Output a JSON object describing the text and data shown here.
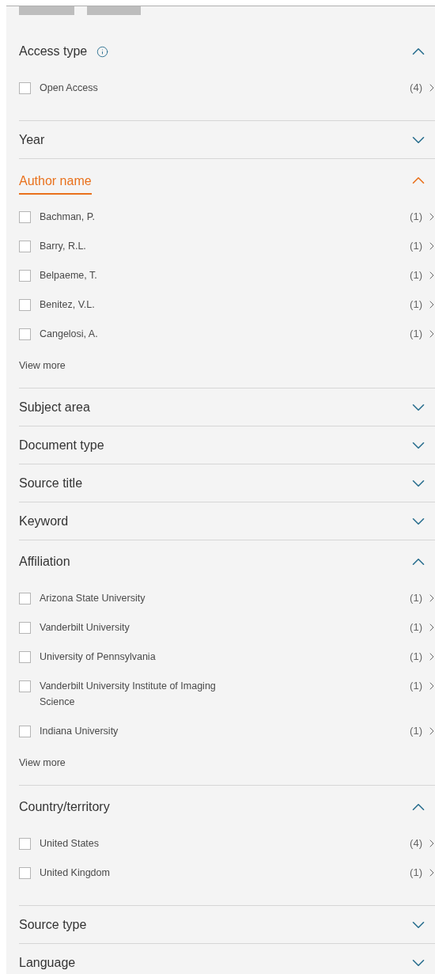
{
  "top_buttons": [
    {
      "kind": "cut"
    },
    {
      "kind": "cut"
    }
  ],
  "sections": [
    {
      "title": "Access type",
      "info": true,
      "expanded": true,
      "active": false,
      "items": [
        {
          "label": "Open Access",
          "count": "(4)",
          "checked": false
        }
      ]
    },
    {
      "title": "Year",
      "info": false,
      "expanded": false,
      "active": false
    },
    {
      "title": "Author name",
      "info": false,
      "expanded": true,
      "active": true,
      "items": [
        {
          "label": "Bachman, P.",
          "count": "(1)",
          "checked": false
        },
        {
          "label": "Barry, R.L.",
          "count": "(1)",
          "checked": false
        },
        {
          "label": "Belpaeme, T.",
          "count": "(1)",
          "checked": false
        },
        {
          "label": "Benitez, V.L.",
          "count": "(1)",
          "checked": false
        },
        {
          "label": "Cangelosi, A.",
          "count": "(1)",
          "checked": false
        }
      ],
      "view_more": "View more"
    },
    {
      "title": "Subject area",
      "info": false,
      "expanded": false,
      "active": false
    },
    {
      "title": "Document type",
      "info": false,
      "expanded": false,
      "active": false
    },
    {
      "title": "Source title",
      "info": false,
      "expanded": false,
      "active": false
    },
    {
      "title": "Keyword",
      "info": false,
      "expanded": false,
      "active": false
    },
    {
      "title": "Affiliation",
      "info": false,
      "expanded": true,
      "active": false,
      "items": [
        {
          "label": "Arizona State University",
          "count": "(1)",
          "checked": false
        },
        {
          "label": "Vanderbilt University",
          "count": "(1)",
          "checked": false
        },
        {
          "label": "University of Pennsylvania",
          "count": "(1)",
          "checked": false
        },
        {
          "label": "Vanderbilt University Institute of Imaging Science",
          "count": "(1)",
          "checked": false
        },
        {
          "label": "Indiana University",
          "count": "(1)",
          "checked": false
        }
      ],
      "view_more": "View more"
    },
    {
      "title": "Country/territory",
      "info": false,
      "expanded": true,
      "active": false,
      "items": [
        {
          "label": "United States",
          "count": "(4)",
          "checked": false
        },
        {
          "label": "United Kingdom",
          "count": "(1)",
          "checked": false
        }
      ]
    },
    {
      "title": "Source type",
      "info": false,
      "expanded": false,
      "active": false
    },
    {
      "title": "Language",
      "info": false,
      "expanded": false,
      "active": false
    }
  ]
}
